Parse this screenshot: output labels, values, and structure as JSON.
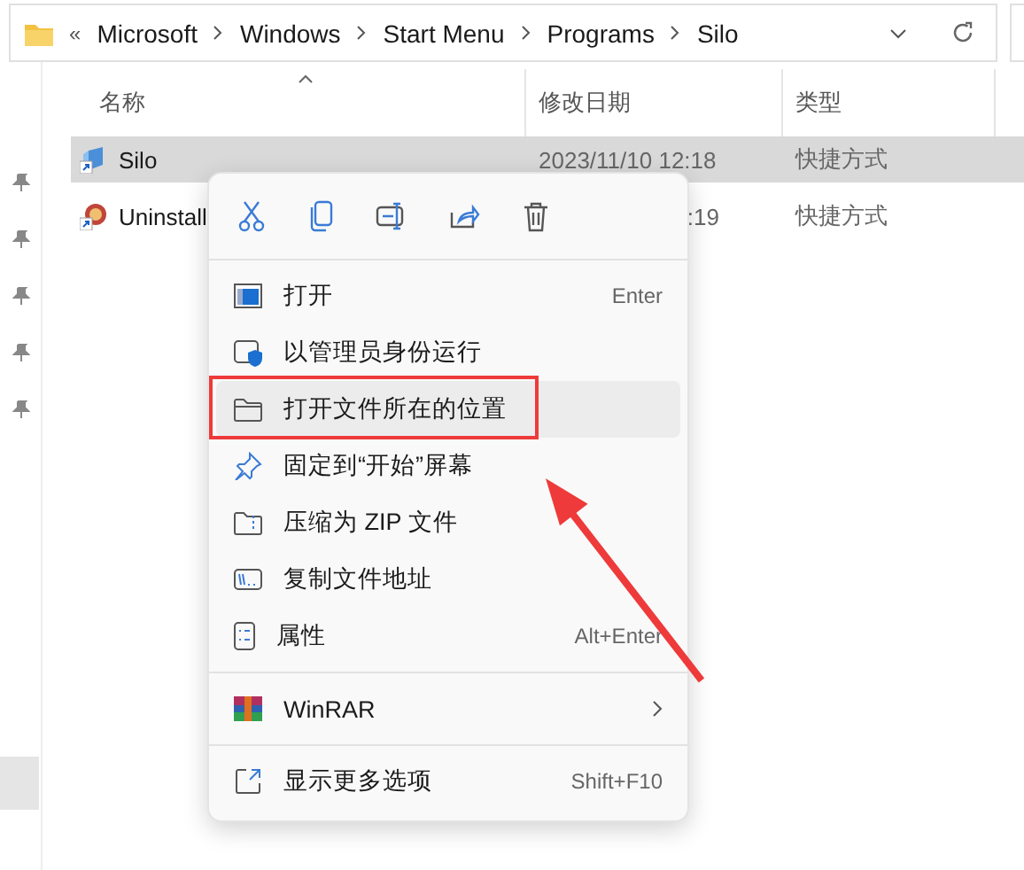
{
  "address_bar": {
    "overflow": "«",
    "crumbs": [
      "Microsoft",
      "Windows",
      "Start Menu",
      "Programs",
      "Silo"
    ]
  },
  "columns": [
    {
      "label": "名称",
      "sorted": true
    },
    {
      "label": "修改日期",
      "sorted": false
    },
    {
      "label": "类型",
      "sorted": false
    }
  ],
  "rows": [
    {
      "name": "Silo",
      "date": "2023/11/10 12:18",
      "type": "快捷方式",
      "selected": true
    },
    {
      "name": "Uninstall",
      "date": ":19",
      "type": "快捷方式",
      "selected": false
    }
  ],
  "context_menu": {
    "groups": [
      [
        {
          "label": "打开",
          "shortcut": "Enter",
          "hovered": false,
          "highlighted": false,
          "submenu": false
        },
        {
          "label": "以管理员身份运行",
          "hovered": false,
          "highlighted": false,
          "submenu": false
        },
        {
          "label": "打开文件所在的位置",
          "hovered": true,
          "highlighted": true,
          "submenu": false
        },
        {
          "label": "固定到“开始”屏幕",
          "hovered": false,
          "highlighted": false,
          "submenu": false
        },
        {
          "label": "压缩为 ZIP 文件",
          "hovered": false,
          "highlighted": false,
          "submenu": false
        },
        {
          "label": "复制文件地址",
          "hovered": false,
          "highlighted": false,
          "submenu": false
        },
        {
          "label": "属性",
          "shortcut": "Alt+Enter",
          "hovered": false,
          "highlighted": false,
          "submenu": false
        }
      ],
      [
        {
          "label": "WinRAR",
          "hovered": false,
          "highlighted": false,
          "submenu": true
        }
      ],
      [
        {
          "label": "显示更多选项",
          "shortcut": "Shift+F10",
          "hovered": false,
          "highlighted": false,
          "submenu": false
        }
      ]
    ]
  }
}
